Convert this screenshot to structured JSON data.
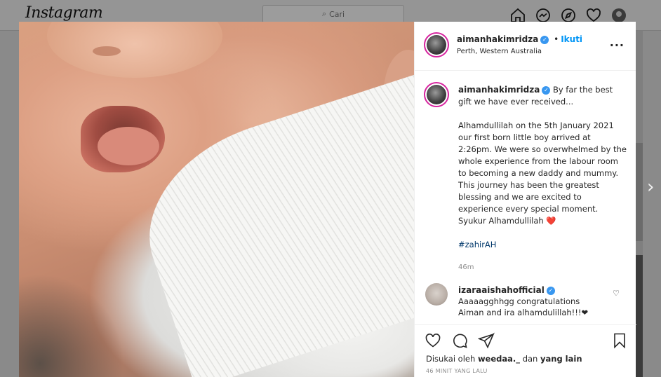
{
  "nav": {
    "logo": "Instagram",
    "search_placeholder": "Cari",
    "icons": [
      "home-icon",
      "messenger-icon",
      "explore-icon",
      "activity-heart-icon",
      "profile-avatar"
    ]
  },
  "post": {
    "username": "aimanhakimridza",
    "follow_label": "Ikuti",
    "separator": "•",
    "location": "Perth, Western Australia",
    "more_label": "...",
    "caption_intro": "By far the best gift we have ever received...",
    "caption_body": "Alhamdullilah on the 5th January 2021 our first born little boy arrived at 2:26pm. We were so overwhelmed by the whole experience from the labour room to becoming a new daddy and mummy. This journey has been the greatest blessing and we are excited to experience every special moment. Syukur Alhamdullilah",
    "caption_heart": "❤️",
    "hashtag": "#zahirAH",
    "caption_time": "46m",
    "comment": {
      "username": "izaraaishahofficial",
      "text": "Aaaaagghhgg congratulations Aiman and ira alhamdulillah!!!❤"
    },
    "likes_prefix": "Disukai oleh",
    "likes_user": "weedaa._",
    "likes_middle": "dan",
    "likes_suffix": "yang lain",
    "posted_ago": "46 MINIT YANG LALU"
  },
  "colors": {
    "accent": "#0095f6",
    "verified": "#3897f0",
    "heart": "#e0245e",
    "story_ring": "#d6249f"
  }
}
